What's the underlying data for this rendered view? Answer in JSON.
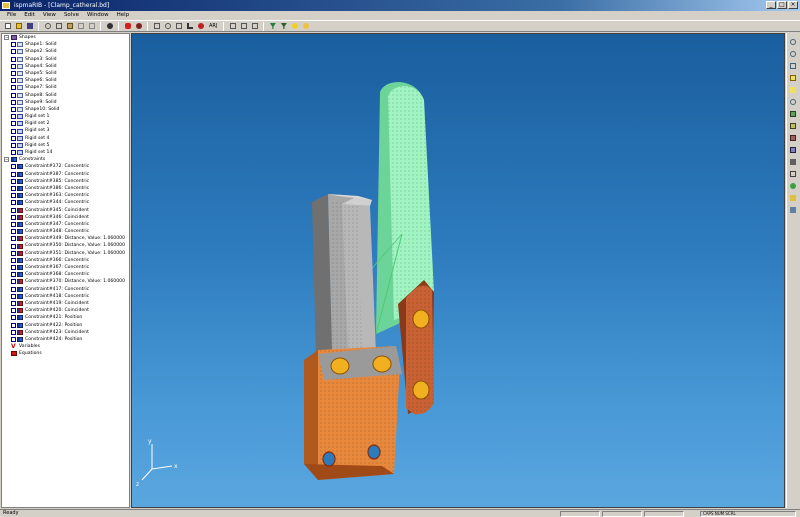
{
  "window": {
    "title": "ispmaRIB - [Clamp_catheral.bd]",
    "controls": [
      "_",
      "□",
      "×"
    ]
  },
  "menu": [
    "File",
    "Edit",
    "View",
    "Solve",
    "Window",
    "Help"
  ],
  "toolbar": {
    "text_button": "ARJ"
  },
  "tree": {
    "shapes_root": "Shapes",
    "shapes": [
      "Shape1: Solid",
      "Shape2: Solid",
      "Shape3: Solid",
      "Shape4: Solid",
      "Shape5: Solid",
      "Shape6: Solid",
      "Shape7: Solid",
      "Shape8: Solid",
      "Shape9: Solid",
      "Shape10: Solid"
    ],
    "rigid_sets": [
      "Rigid set 1",
      "Rigid set 2",
      "Rigid set 3",
      "Rigid set 4",
      "Rigid set 5",
      "Rigid set 14"
    ],
    "constraints_root": "Constraints",
    "constraints": [
      {
        "label": "Constraint#372: Concentric",
        "kind": "con"
      },
      {
        "label": "Constraint#387: Concentric",
        "kind": "con"
      },
      {
        "label": "Constraint#385: Concentric",
        "kind": "con"
      },
      {
        "label": "Constraint#386: Concentric",
        "kind": "con"
      },
      {
        "label": "Constraint#363: Concentric",
        "kind": "con"
      },
      {
        "label": "Constraint#344: Concentric",
        "kind": "con"
      },
      {
        "label": "Constraint#345: Coincident",
        "kind": "conr"
      },
      {
        "label": "Constraint#346: Coincident",
        "kind": "conr"
      },
      {
        "label": "Constraint#347: Concentric",
        "kind": "con"
      },
      {
        "label": "Constraint#348: Concentric",
        "kind": "con"
      },
      {
        "label": "Constraint#349: Distance, Value: 1.060000",
        "kind": "conr"
      },
      {
        "label": "Constraint#350: Distance, Value: 1.060000",
        "kind": "conr"
      },
      {
        "label": "Constraint#351: Distance, Value: 1.060000",
        "kind": "conr"
      },
      {
        "label": "Constraint#366: Concentric",
        "kind": "con"
      },
      {
        "label": "Constraint#367: Concentric",
        "kind": "con"
      },
      {
        "label": "Constraint#368: Concentric",
        "kind": "con"
      },
      {
        "label": "Constraint#370: Distance, Value: 1.060000",
        "kind": "conr"
      },
      {
        "label": "Constraint#417: Concentric",
        "kind": "con"
      },
      {
        "label": "Constraint#418: Concentric",
        "kind": "con"
      },
      {
        "label": "Constraint#419: Coincident",
        "kind": "conr"
      },
      {
        "label": "Constraint#420: Coincident",
        "kind": "conr"
      },
      {
        "label": "Constraint#421: Position",
        "kind": "con"
      },
      {
        "label": "Constraint#422: Position",
        "kind": "con"
      },
      {
        "label": "Constraint#423: Coincident",
        "kind": "conr"
      },
      {
        "label": "Constraint#424: Position",
        "kind": "con"
      }
    ],
    "variables": "Variables",
    "equations": "Equations"
  },
  "axes": {
    "x": "x",
    "y": "y",
    "z": "z"
  },
  "status": {
    "left": "Ready",
    "cells": [
      "",
      "",
      "",
      "CAPS NUM SCRL"
    ]
  },
  "colors": {
    "viewport_top": "#1a5e9e",
    "viewport_bottom": "#5aa6df",
    "lever_green": "#8ff0b8",
    "orange_base": "#e08040",
    "link_brown": "#c05a30",
    "jaw_grey": "#a8a8a8",
    "pin_yellow": "#f0b020"
  }
}
